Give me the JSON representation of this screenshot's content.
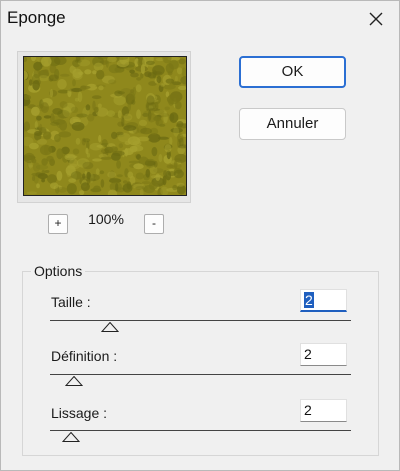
{
  "window": {
    "title": "Eponge"
  },
  "preview": {
    "zoom_label": "100%",
    "zoom_in_label": "+",
    "zoom_out_label": "-",
    "texture_colors": [
      "#8f881c",
      "#7b7716",
      "#a6a02e",
      "#6b6a12"
    ]
  },
  "buttons": {
    "ok_label": "OK",
    "cancel_label": "Annuler"
  },
  "options": {
    "legend": "Options",
    "items": [
      {
        "label": "Taille :",
        "value": "2",
        "slider_fraction": 0.2
      },
      {
        "label": "Définition :",
        "value": "2",
        "slider_fraction": 0.08
      },
      {
        "label": "Lissage :",
        "value": "2",
        "slider_fraction": 0.07
      }
    ]
  }
}
